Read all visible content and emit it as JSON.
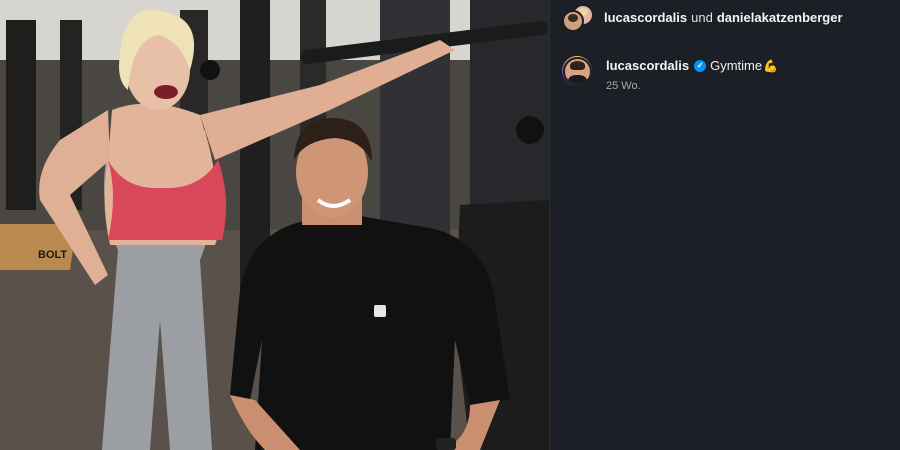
{
  "header": {
    "user1": "lucascordalis",
    "conjunction": "und",
    "user2": "danielakatzenberger"
  },
  "post": {
    "username": "lucascordalis",
    "caption": "Gymtime",
    "emoji": "💪",
    "timestamp": "25 Wo."
  },
  "photo": {
    "floor_sign_text": "BOLT"
  },
  "colors": {
    "panel_bg": "#1c1f26",
    "verified_badge": "#0095f6",
    "sports_bra": "#d9475a",
    "shirt": "#111111"
  },
  "icons": [
    "verified-badge-icon",
    "flexed-biceps-emoji"
  ]
}
